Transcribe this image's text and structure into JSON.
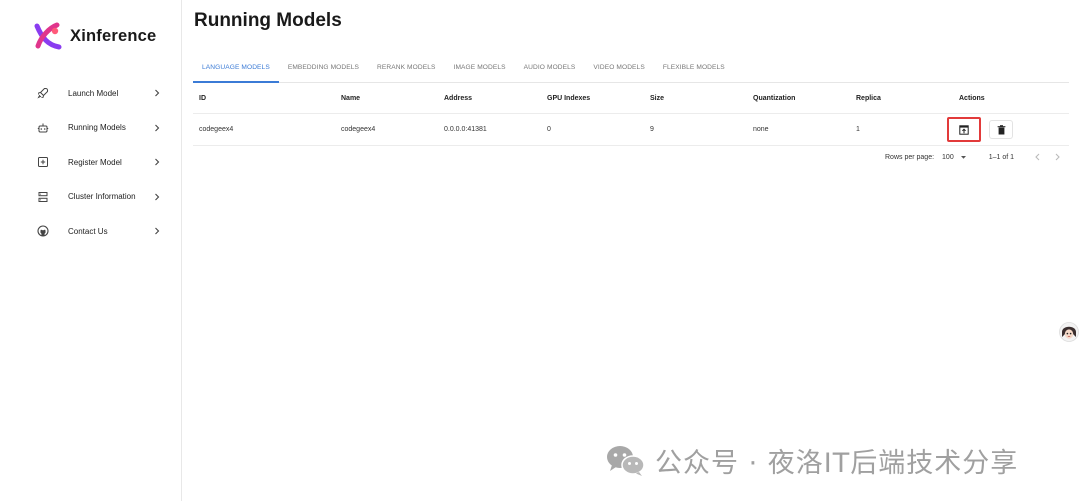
{
  "brand": {
    "name": "Xinference"
  },
  "sidebar": {
    "items": [
      {
        "label": "Launch Model",
        "icon": "rocket-icon"
      },
      {
        "label": "Running Models",
        "icon": "robot-icon"
      },
      {
        "label": "Register Model",
        "icon": "add-box-icon"
      },
      {
        "label": "Cluster Information",
        "icon": "server-icon"
      },
      {
        "label": "Contact Us",
        "icon": "github-icon"
      }
    ]
  },
  "main": {
    "title": "Running Models",
    "tabs": [
      {
        "label": "LANGUAGE MODELS",
        "active": true
      },
      {
        "label": "EMBEDDING MODELS",
        "active": false
      },
      {
        "label": "RERANK MODELS",
        "active": false
      },
      {
        "label": "IMAGE MODELS",
        "active": false
      },
      {
        "label": "AUDIO MODELS",
        "active": false
      },
      {
        "label": "VIDEO MODELS",
        "active": false
      },
      {
        "label": "FLEXIBLE MODELS",
        "active": false
      }
    ],
    "table": {
      "headers": [
        "ID",
        "Name",
        "Address",
        "GPU Indexes",
        "Size",
        "Quantization",
        "Replica",
        "Actions"
      ],
      "rows": [
        {
          "id": "codegeex4",
          "name": "codegeex4",
          "address": "0.0.0.0:41381",
          "gpu_indexes": "0",
          "size": "9",
          "quantization": "none",
          "replica": "1"
        }
      ]
    },
    "pagination": {
      "rows_per_page_label": "Rows per page:",
      "rows_per_page": "100",
      "range": "1–1 of 1"
    }
  },
  "watermark": {
    "text": "公众号 · 夜洛IT后端技术分享"
  },
  "colors": {
    "accent": "#3b7bd6",
    "highlight": "#e23a3a"
  }
}
